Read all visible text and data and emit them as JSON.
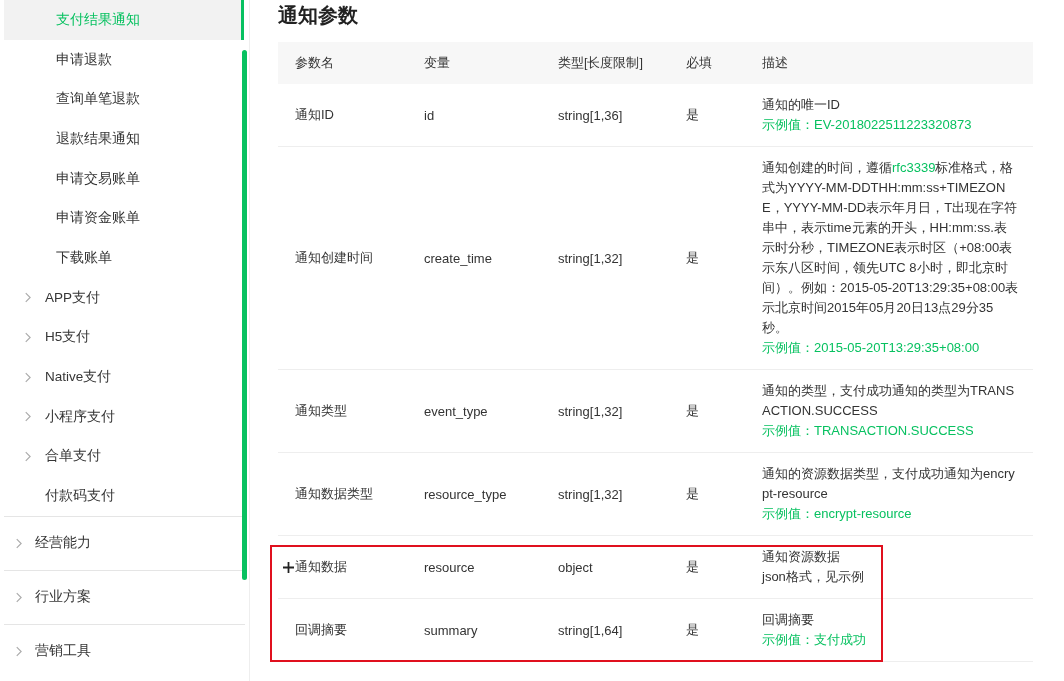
{
  "sidebar": {
    "items": [
      {
        "label": "支付结果通知",
        "kind": "sub",
        "selected": true
      },
      {
        "label": "申请退款",
        "kind": "sub",
        "selected": false
      },
      {
        "label": "查询单笔退款",
        "kind": "sub",
        "selected": false
      },
      {
        "label": "退款结果通知",
        "kind": "sub",
        "selected": false
      },
      {
        "label": "申请交易账单",
        "kind": "sub",
        "selected": false
      },
      {
        "label": "申请资金账单",
        "kind": "sub",
        "selected": false
      },
      {
        "label": "下载账单",
        "kind": "sub",
        "selected": false
      },
      {
        "label": "APP支付",
        "kind": "group",
        "selected": false
      },
      {
        "label": "H5支付",
        "kind": "group",
        "selected": false
      },
      {
        "label": "Native支付",
        "kind": "group",
        "selected": false
      },
      {
        "label": "小程序支付",
        "kind": "group",
        "selected": false
      },
      {
        "label": "合单支付",
        "kind": "group",
        "selected": false
      },
      {
        "label": "付款码支付",
        "kind": "leaf",
        "selected": false
      },
      {
        "label": "经营能力",
        "kind": "section",
        "selected": false
      },
      {
        "label": "行业方案",
        "kind": "section",
        "selected": false
      },
      {
        "label": "营销工具",
        "kind": "section",
        "selected": false
      }
    ]
  },
  "section_title": "通知参数",
  "table": {
    "columns": [
      "参数名",
      "变量",
      "类型[长度限制]",
      "必填",
      "描述"
    ],
    "rows": [
      {
        "name": "通知ID",
        "variable": "id",
        "type": "string[1,36]",
        "required": "是",
        "description": [
          {
            "kind": "plain",
            "text": "通知的唯一ID"
          }
        ],
        "example": "示例值：EV-2018022511223320873",
        "expandable": false,
        "highlighted": false
      },
      {
        "name": "通知创建时间",
        "variable": "create_time",
        "type": "string[1,32]",
        "required": "是",
        "description": [
          {
            "kind": "plain",
            "text": "通知创建的时间，遵循"
          },
          {
            "kind": "link",
            "text": "rfc3339"
          },
          {
            "kind": "plain",
            "text": "标准格式，格式为YYYY-MM-DDTHH:mm:ss+TIMEZONE，YYYY-MM-DD表示年月日，T出现在字符串中，表示time元素的开头，HH:mm:ss.表示时分秒，TIMEZONE表示时区（+08:00表示东八区时间，领先UTC 8小时，即北京时间）。例如：2015-05-20T13:29:35+08:00表示北京时间2015年05月20日13点29分35秒。"
          }
        ],
        "example": "示例值：2015-05-20T13:29:35+08:00",
        "expandable": false,
        "highlighted": false
      },
      {
        "name": "通知类型",
        "variable": "event_type",
        "type": "string[1,32]",
        "required": "是",
        "description": [
          {
            "kind": "plain",
            "text": "通知的类型，支付成功通知的类型为TRANSACTION.SUCCESS"
          }
        ],
        "example": "示例值：TRANSACTION.SUCCESS",
        "expandable": false,
        "highlighted": false
      },
      {
        "name": "通知数据类型",
        "variable": "resource_type",
        "type": "string[1,32]",
        "required": "是",
        "description": [
          {
            "kind": "plain",
            "text": "通知的资源数据类型，支付成功通知为encrypt-resource"
          }
        ],
        "example": "示例值：encrypt-resource",
        "expandable": false,
        "highlighted": false
      },
      {
        "name": "通知数据",
        "variable": "resource",
        "type": "object",
        "required": "是",
        "description": [
          {
            "kind": "plain",
            "text": "通知资源数据"
          },
          {
            "kind": "break",
            "text": "json格式，见示例"
          }
        ],
        "example": "",
        "expandable": true,
        "highlighted": true
      },
      {
        "name": "回调摘要",
        "variable": "summary",
        "type": "string[1,64]",
        "required": "是",
        "description": [
          {
            "kind": "plain",
            "text": "回调摘要"
          }
        ],
        "example": "示例值：支付成功",
        "expandable": false,
        "highlighted": true
      }
    ]
  }
}
